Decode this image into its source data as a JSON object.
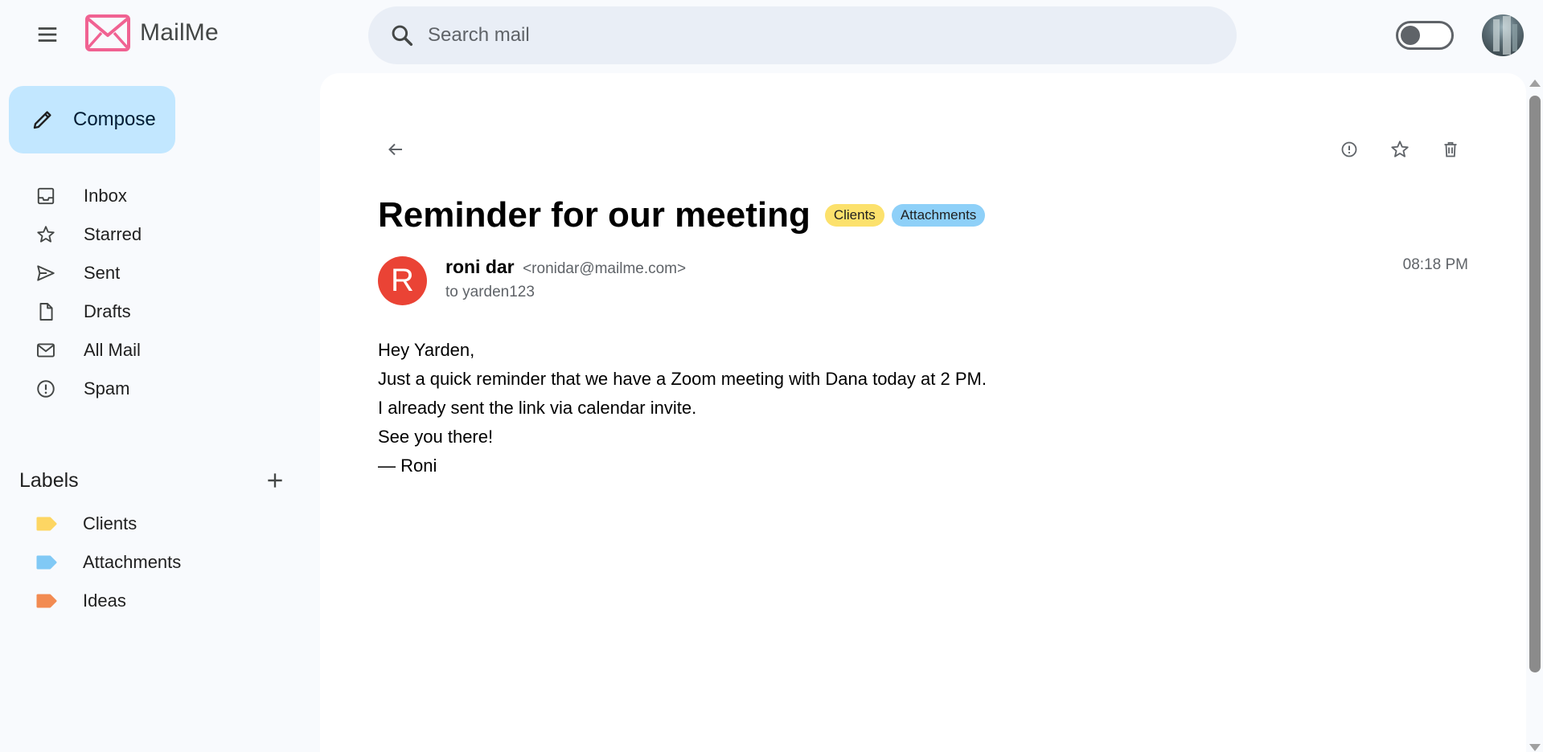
{
  "app": {
    "name": "MailMe",
    "logo_color": "#f06292"
  },
  "search": {
    "placeholder": "Search mail"
  },
  "theme_toggle": {
    "state": "off"
  },
  "sidebar": {
    "compose_label": "Compose",
    "items": [
      {
        "label": "Inbox",
        "icon": "inbox-icon"
      },
      {
        "label": "Starred",
        "icon": "star-icon"
      },
      {
        "label": "Sent",
        "icon": "send-icon"
      },
      {
        "label": "Drafts",
        "icon": "draft-icon"
      },
      {
        "label": "All Mail",
        "icon": "mail-icon"
      },
      {
        "label": "Spam",
        "icon": "spam-icon"
      }
    ],
    "labels_heading": "Labels",
    "labels": [
      {
        "label": "Clients",
        "color": "#fdd663"
      },
      {
        "label": "Attachments",
        "color": "#81c9f5"
      },
      {
        "label": "Ideas",
        "color": "#f28b52"
      }
    ]
  },
  "email": {
    "subject": "Reminder for our meeting",
    "chips": [
      {
        "label": "Clients",
        "color": "#fce16c"
      },
      {
        "label": "Attachments",
        "color": "#8ed0f8"
      }
    ],
    "sender": {
      "initial": "R",
      "name": "roni dar",
      "email": "<ronidar@mailme.com>",
      "avatar_color": "#ea4335"
    },
    "to": "to yarden123",
    "time": "08:18 PM",
    "body": [
      "Hey Yarden,",
      "Just a quick reminder that we have a Zoom meeting with Dana today at 2 PM.",
      "I already sent the link via calendar invite.",
      "See you there!",
      "— Roni"
    ]
  }
}
